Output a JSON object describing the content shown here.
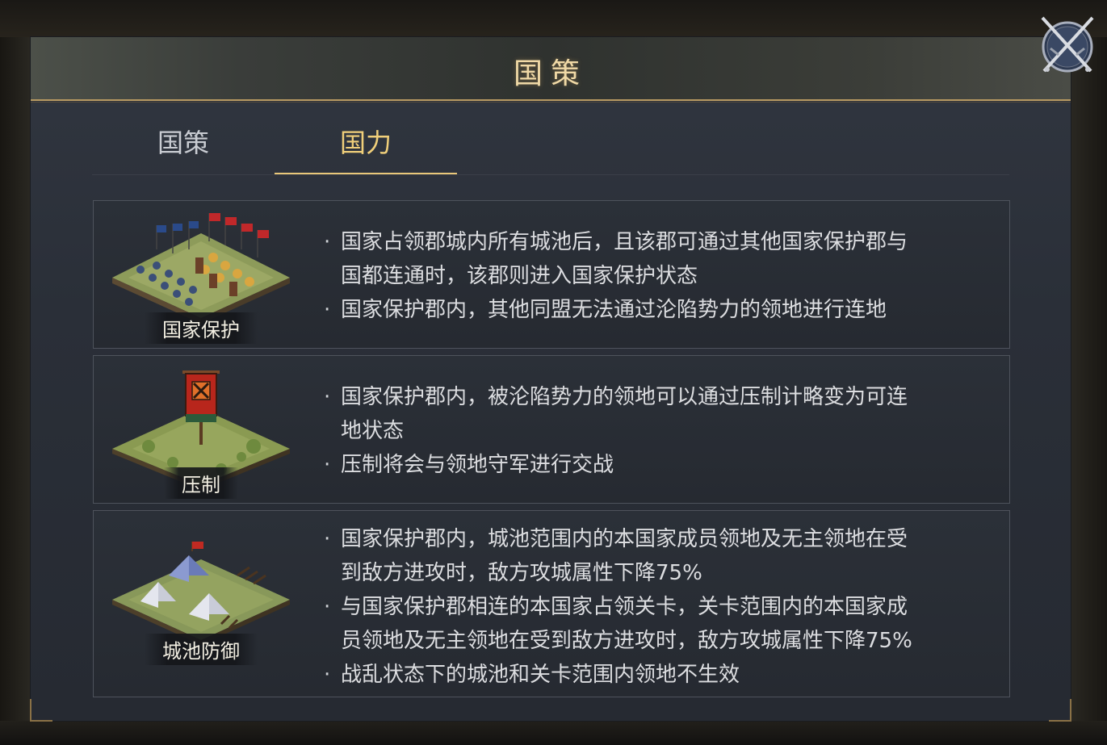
{
  "title": "国策",
  "tabs": [
    {
      "label": "国策",
      "selected": false
    },
    {
      "label": "国力",
      "selected": true
    }
  ],
  "cards": [
    {
      "label": "国家保护",
      "lines": [
        "国家占领郡城内所有城池后，且该郡可通过其他国家保护郡与",
        "国都连通时，该郡则进入国家保护状态",
        "国家保护郡内，其他同盟无法通过沦陷势力的领地进行连地"
      ]
    },
    {
      "label": "压制",
      "lines": [
        "国家保护郡内，被沦陷势力的领地可以通过压制计略变为可连",
        "地状态",
        "压制将会与领地守军进行交战"
      ]
    },
    {
      "label": "城池防御",
      "lines": [
        "国家保护郡内，城池范围内的本国家成员领地及无主领地在受",
        "到敌方进攻时，敌方攻城属性下降75%",
        "与国家保护郡相连的本国家占领关卡，关卡范围内的本国家成",
        "员领地及无主领地在受到敌方进攻时，敌方攻城属性下降75%",
        "战乱状态下的城池和关卡范围内领地不生效"
      ]
    }
  ],
  "icons": {
    "close": "crossed-swords-close-icon"
  },
  "colors": {
    "title": "#f0d9a6",
    "tab_active": "#f0cf7a",
    "tab_inactive": "#c9ccd2",
    "accent_line": "#e9c77a",
    "body_text": "#dcdde0"
  }
}
